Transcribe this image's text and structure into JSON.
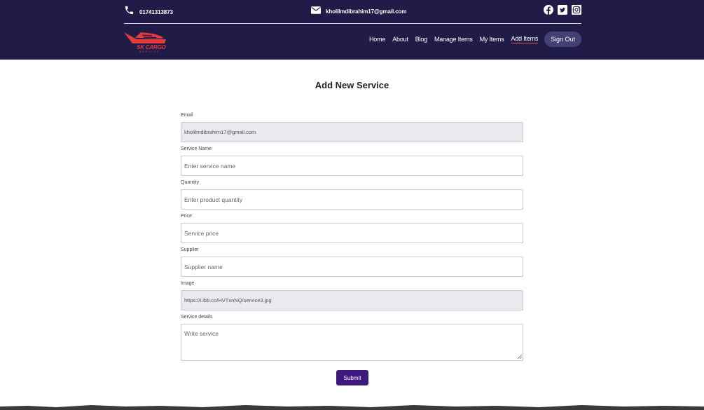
{
  "topbar": {
    "phone": "01741313873",
    "email": "kholilmdibrahim17@gmail.com",
    "social_icons": [
      "facebook-icon",
      "twitter-icon",
      "instagram-icon"
    ]
  },
  "logo": {
    "text": "SK CARGO",
    "subtext": "SERVICE"
  },
  "nav": {
    "items": [
      "Home",
      "About",
      "Blog",
      "Manage Items",
      "My Items",
      "Add Items"
    ],
    "active": "Add Items",
    "sign_out": "Sign Out"
  },
  "page_title": "Add New Service",
  "form": {
    "email": {
      "label": "Email",
      "value": "kholilmdibrahim17@gmail.com"
    },
    "service_name": {
      "label": "Service Name",
      "placeholder": "Enter service name"
    },
    "quantity": {
      "label": "Quantity",
      "placeholder": "Enter product quantity"
    },
    "price": {
      "label": "Price",
      "placeholder": "Service price"
    },
    "supplier": {
      "label": "Supplier",
      "placeholder": "Supplier name"
    },
    "image": {
      "label": "Image",
      "value": "https://i.ibb.co/HVTxnNQ/service3.jpg"
    },
    "details": {
      "label": "Service details",
      "placeholder": "Write service"
    },
    "submit": "Submit"
  },
  "colors": {
    "header_bg": "#211c47",
    "accent": "#3f1a7e",
    "logo_red": "#e23b3b"
  }
}
